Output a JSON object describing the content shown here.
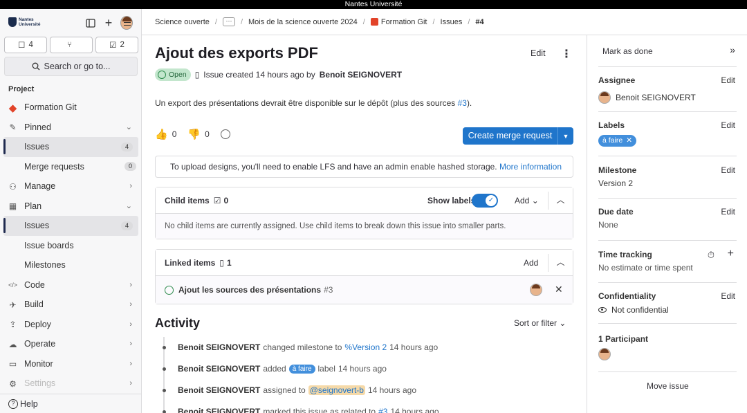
{
  "system_title": "Nantes Université",
  "sidebar": {
    "logo_line1": "Nantes",
    "logo_line2": "Université",
    "counters": [
      {
        "icon": "issues-icon",
        "glyph": "☐",
        "count": "4"
      },
      {
        "icon": "merge-request-icon",
        "glyph": "⑂",
        "count": ""
      },
      {
        "icon": "todo-icon",
        "glyph": "☑",
        "count": "2"
      }
    ],
    "search_label": "Search or go to...",
    "section": "Project",
    "items": [
      {
        "label": "Formation Git",
        "icon": "project-icon",
        "glyph": "◆",
        "badge": "",
        "chev": "",
        "sub": false,
        "active": false
      },
      {
        "label": "Pinned",
        "icon": "pin-icon",
        "glyph": "✎",
        "badge": "",
        "chev": "⌄",
        "sub": false,
        "active": false
      },
      {
        "label": "Issues",
        "icon": "",
        "glyph": "",
        "badge": "4",
        "chev": "",
        "sub": true,
        "active": true
      },
      {
        "label": "Merge requests",
        "icon": "",
        "glyph": "",
        "badge": "0",
        "chev": "",
        "sub": true,
        "active": false
      },
      {
        "label": "Manage",
        "icon": "users-icon",
        "glyph": "⚇",
        "badge": "",
        "chev": "›",
        "sub": false,
        "active": false
      },
      {
        "label": "Plan",
        "icon": "calendar-icon",
        "glyph": "▦",
        "badge": "",
        "chev": "⌄",
        "sub": false,
        "active": false
      },
      {
        "label": "Issues",
        "icon": "",
        "glyph": "",
        "badge": "4",
        "chev": "",
        "sub": true,
        "active": true
      },
      {
        "label": "Issue boards",
        "icon": "",
        "glyph": "",
        "badge": "",
        "chev": "",
        "sub": true,
        "active": false
      },
      {
        "label": "Milestones",
        "icon": "",
        "glyph": "",
        "badge": "",
        "chev": "",
        "sub": true,
        "active": false
      },
      {
        "label": "Code",
        "icon": "code-icon",
        "glyph": "</>",
        "badge": "",
        "chev": "›",
        "sub": false,
        "active": false
      },
      {
        "label": "Build",
        "icon": "rocket-icon",
        "glyph": "✈",
        "badge": "",
        "chev": "›",
        "sub": false,
        "active": false
      },
      {
        "label": "Deploy",
        "icon": "deploy-icon",
        "glyph": "⇪",
        "badge": "",
        "chev": "›",
        "sub": false,
        "active": false
      },
      {
        "label": "Operate",
        "icon": "cloud-icon",
        "glyph": "☁",
        "badge": "",
        "chev": "›",
        "sub": false,
        "active": false
      },
      {
        "label": "Monitor",
        "icon": "monitor-icon",
        "glyph": "▭",
        "badge": "",
        "chev": "›",
        "sub": false,
        "active": false
      },
      {
        "label": "Settings",
        "icon": "settings-icon",
        "glyph": "⚙",
        "badge": "",
        "chev": "›",
        "sub": false,
        "active": false,
        "dim": true
      }
    ],
    "help": "Help"
  },
  "breadcrumb": {
    "items": [
      "Science ouverte",
      "Mois de la science ouverte 2024",
      "Formation Git",
      "Issues"
    ],
    "current": "#4"
  },
  "issue": {
    "title": "Ajout des exports PDF",
    "edit_label": "Edit",
    "status": "Open",
    "created_text": "Issue created 14 hours ago by",
    "author": "Benoit SEIGNOVERT",
    "description_text": "Un export des présentations devrait être disponible sur le dépôt (plus des sources ",
    "description_link": "#3",
    "description_end": ").",
    "thumbs_up": "0",
    "thumbs_down": "0",
    "create_mr_label": "Create merge request",
    "lfs_text": "To upload designs, you'll need to enable LFS and have an admin enable hashed storage.",
    "lfs_link": "More information"
  },
  "child_items": {
    "title": "Child items",
    "count": "0",
    "show_labels": "Show labels",
    "add_label": "Add",
    "empty_text": "No child items are currently assigned. Use child items to break down this issue into smaller parts."
  },
  "linked_items": {
    "title": "Linked items",
    "count": "1",
    "add_label": "Add",
    "item_title": "Ajout les sources des présentations",
    "item_ref": "#3"
  },
  "activity": {
    "title": "Activity",
    "sort_label": "Sort or filter",
    "events": [
      {
        "author": "Benoit SEIGNOVERT",
        "action": "changed milestone to",
        "target": "%Version 2",
        "target_kind": "link",
        "tail": "",
        "time": "14 hours ago"
      },
      {
        "author": "Benoit SEIGNOVERT",
        "action": "added",
        "target": "à faire",
        "target_kind": "label",
        "tail": "label",
        "time": "14 hours ago"
      },
      {
        "author": "Benoit SEIGNOVERT",
        "action": "assigned to",
        "target": "@seignovert-b",
        "target_kind": "mention",
        "tail": "",
        "time": "14 hours ago"
      },
      {
        "author": "Benoit SEIGNOVERT",
        "action": "marked this issue as related to",
        "target": "#3",
        "target_kind": "link",
        "tail": "",
        "time": "14 hours ago"
      }
    ]
  },
  "right_sidebar": {
    "mark_done": "Mark as done",
    "assignee_title": "Assignee",
    "assignee": "Benoit SEIGNOVERT",
    "labels_title": "Labels",
    "label": "à faire",
    "milestone_title": "Milestone",
    "milestone": "Version 2",
    "due_title": "Due date",
    "due": "None",
    "time_title": "Time tracking",
    "time_value": "No estimate or time spent",
    "conf_title": "Confidentiality",
    "conf_value": "Not confidential",
    "participants_title": "1 Participant",
    "move_issue": "Move issue",
    "edit_label": "Edit"
  },
  "colors": {
    "accent": "#1f75cb",
    "open_green": "#2c8a4b",
    "label_blue": "#428fdc"
  }
}
